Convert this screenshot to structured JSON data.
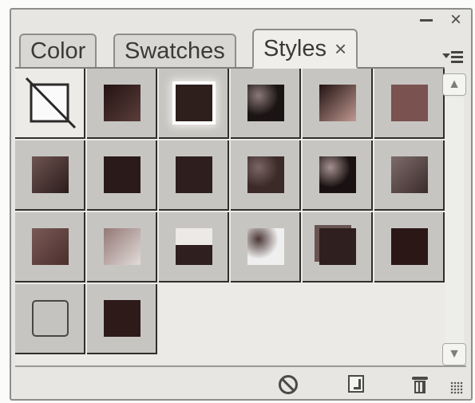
{
  "panel": {
    "tabs": [
      {
        "label": "Color",
        "active": false
      },
      {
        "label": "Swatches",
        "active": false
      },
      {
        "label": "Styles",
        "active": true,
        "close": "×"
      }
    ],
    "close_glyph": "×",
    "menu_icon": "panel-menu-icon"
  },
  "styles": [
    {
      "name": "none",
      "kind": "none"
    },
    {
      "kind": "gradient",
      "c1": "#5a3e3b",
      "c2": "#231312"
    },
    {
      "kind": "glow",
      "c1": "#2e1e1c",
      "glow": "#ffffff"
    },
    {
      "kind": "texture",
      "c1": "#1b1414",
      "c2": "#8b7a78"
    },
    {
      "kind": "gradient",
      "c1": "#c09891",
      "c2": "#221312"
    },
    {
      "kind": "flat",
      "c1": "#7a5250"
    },
    {
      "kind": "gradient",
      "c1": "#2a1c1b",
      "c2": "#6f5551"
    },
    {
      "kind": "flat",
      "c1": "#2a1a19"
    },
    {
      "kind": "flat",
      "c1": "#2e1e1d"
    },
    {
      "kind": "texture",
      "c1": "#3b2a28",
      "c2": "#7a6664"
    },
    {
      "kind": "texture",
      "c1": "#1a1212",
      "c2": "#a5918f"
    },
    {
      "kind": "gradient",
      "c1": "#3b2b2a",
      "c2": "#7d6c6a"
    },
    {
      "kind": "gradient",
      "c1": "#4a2f2d",
      "c2": "#7a5956"
    },
    {
      "kind": "gradient",
      "c1": "#e2dcd9",
      "c2": "#937875"
    },
    {
      "kind": "split",
      "c1": "#ece9e6",
      "c2": "#2f1f1e"
    },
    {
      "kind": "texture",
      "c1": "#efefef",
      "c2": "#4a3634"
    },
    {
      "kind": "offset",
      "c1": "#2f1f1e",
      "c2": "#695452"
    },
    {
      "kind": "flat",
      "c1": "#2a1716"
    },
    {
      "kind": "outline",
      "c1": "#c5c3c0"
    },
    {
      "kind": "flat",
      "c1": "#2e1b19"
    }
  ],
  "footer": {
    "break_link_icon": "break-link-icon",
    "new_style_icon": "new-style-icon",
    "delete_icon": "trash-icon"
  },
  "scrollbar": {
    "up": "up-arrow-icon",
    "down": "down-arrow-icon"
  }
}
